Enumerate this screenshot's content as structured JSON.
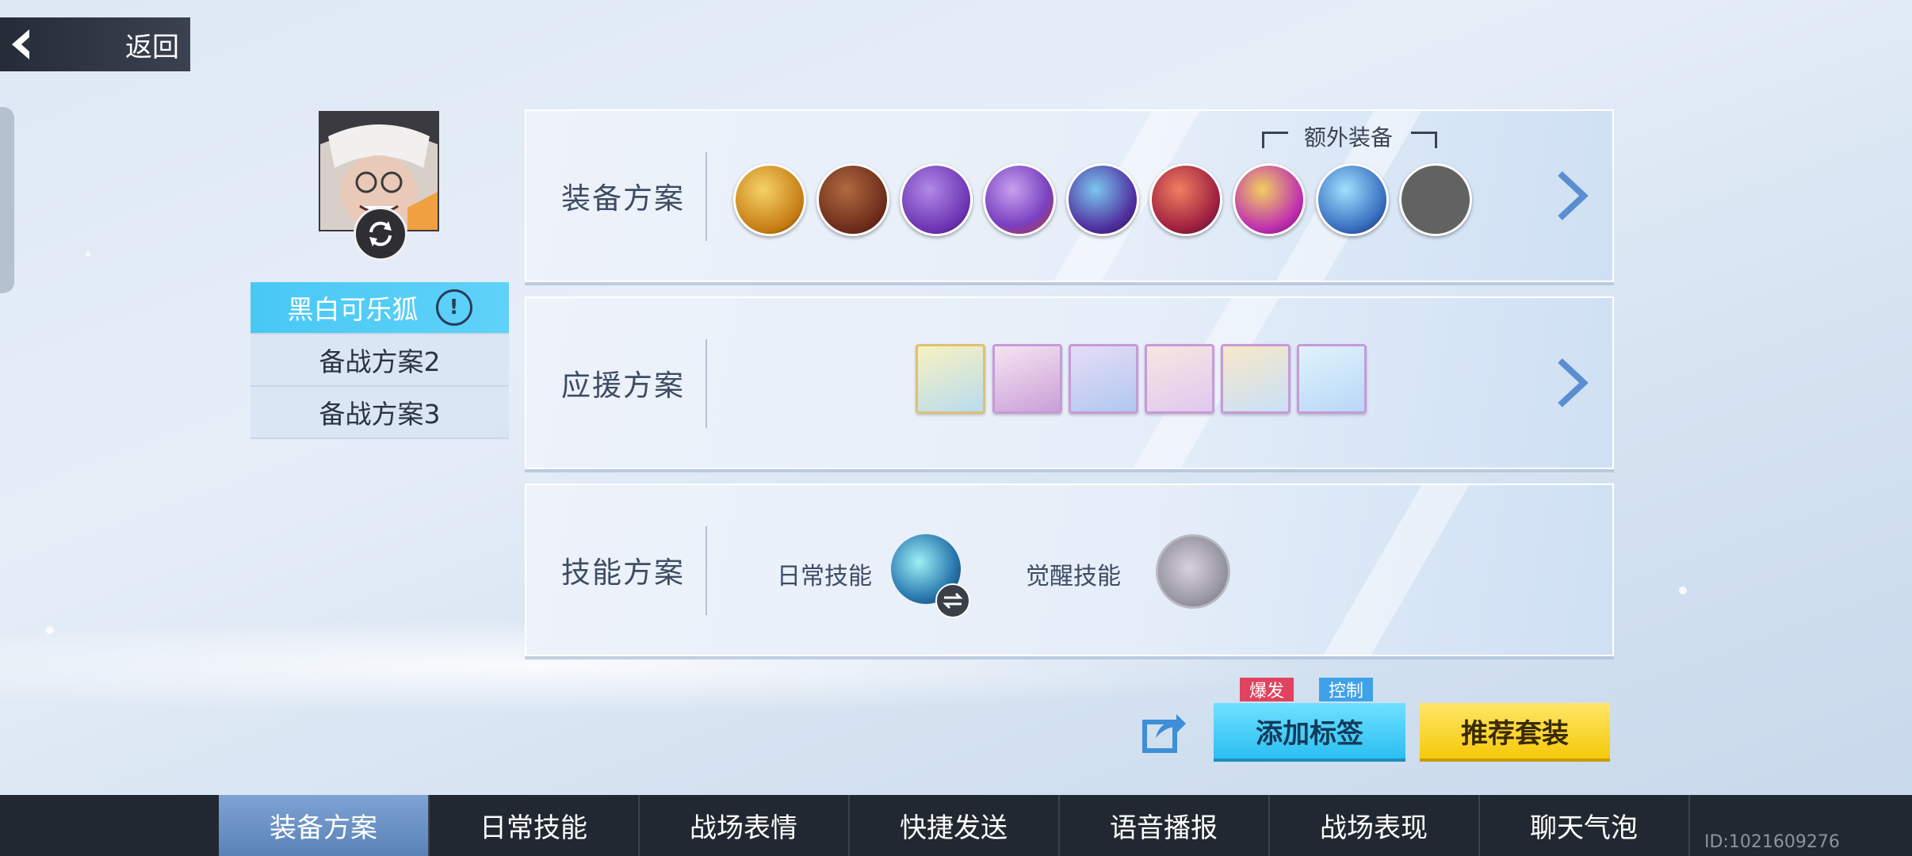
{
  "header": {
    "back_label": "返回"
  },
  "plans": [
    {
      "label": "黑白可乐狐",
      "active": true
    },
    {
      "label": "备战方案2",
      "active": false
    },
    {
      "label": "备战方案3",
      "active": false
    }
  ],
  "equipment": {
    "title": "装备方案",
    "extra_label": "额外装备",
    "items": [
      {
        "icon": "golden-pig-icon",
        "color": "#e0a530"
      },
      {
        "icon": "boot-icon",
        "color": "#7a3a22"
      },
      {
        "icon": "devil-icon",
        "color": "#7b3fb8"
      },
      {
        "icon": "octopus-icon",
        "color": "#8b5cc8"
      },
      {
        "icon": "trophy-icon",
        "color": "#5a3aa8"
      },
      {
        "icon": "lantern-icon",
        "color": "#b02a4a"
      },
      {
        "icon": "helmet-icon",
        "color": "#c03ab0"
      },
      {
        "icon": "card-icon",
        "color": "#2a5da0"
      },
      {
        "icon": "empty-slot",
        "color": "#606060"
      }
    ]
  },
  "support": {
    "title": "应援方案",
    "items": [
      {
        "icon": "duck-sticker-icon",
        "border": "#e0c070"
      },
      {
        "icon": "chef-girl-sticker-icon",
        "border": "#c79ad8"
      },
      {
        "icon": "bird-knight-sticker-icon",
        "border": "#c79ad8"
      },
      {
        "icon": "boy-sticker-icon",
        "border": "#c79ad8"
      },
      {
        "icon": "shiba-sticker-icon",
        "border": "#c79ad8"
      },
      {
        "icon": "blue-girl-sticker-icon",
        "border": "#c79ad8"
      }
    ]
  },
  "skills": {
    "title": "技能方案",
    "daily_label": "日常技能",
    "awaken_label": "觉醒技能"
  },
  "actions": {
    "tag_burst": "爆发",
    "tag_control": "控制",
    "add_tag": "添加标签",
    "recommend": "推荐套装"
  },
  "bottom_tabs": [
    {
      "label": "装备方案",
      "active": true
    },
    {
      "label": "日常技能",
      "active": false
    },
    {
      "label": "战场表情",
      "active": false
    },
    {
      "label": "快捷发送",
      "active": false
    },
    {
      "label": "语音播报",
      "active": false
    },
    {
      "label": "战场表现",
      "active": false
    },
    {
      "label": "聊天气泡",
      "active": false
    }
  ],
  "uid": "ID:1021609276"
}
